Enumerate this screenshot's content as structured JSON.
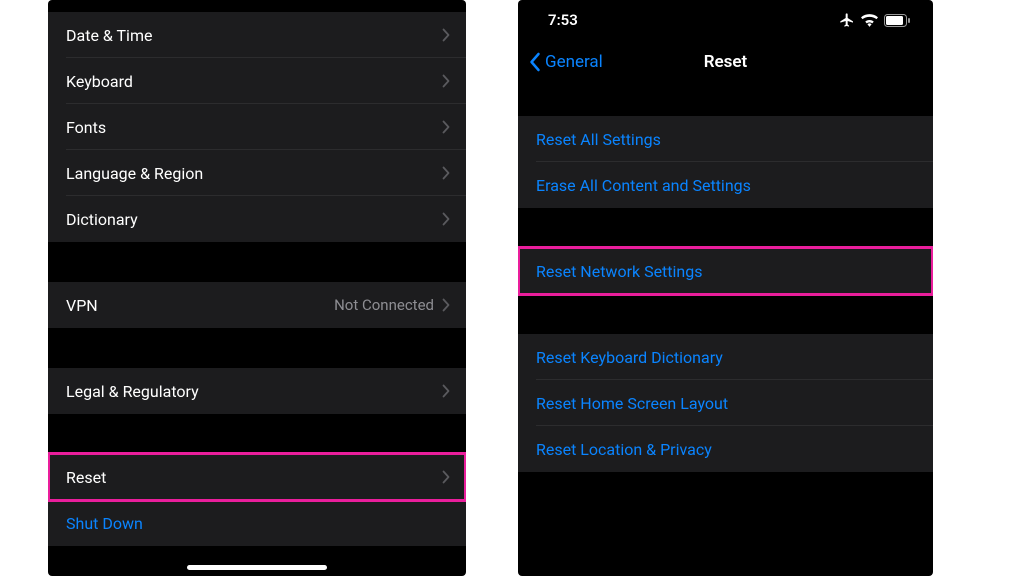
{
  "left": {
    "rows_g1": [
      {
        "label": "Date & Time"
      },
      {
        "label": "Keyboard"
      },
      {
        "label": "Fonts"
      },
      {
        "label": "Language & Region"
      },
      {
        "label": "Dictionary"
      }
    ],
    "rows_g2": [
      {
        "label": "VPN",
        "value": "Not Connected"
      }
    ],
    "rows_g3": [
      {
        "label": "Legal & Regulatory"
      }
    ],
    "rows_g4": [
      {
        "label": "Reset",
        "highlight": true
      },
      {
        "label": "Shut Down",
        "blue": true,
        "nochev": true
      }
    ]
  },
  "right": {
    "status_time": "7:53",
    "nav_back": "General",
    "nav_title": "Reset",
    "rows_g1": [
      {
        "label": "Reset All Settings",
        "blue": true
      },
      {
        "label": "Erase All Content and Settings",
        "blue": true
      }
    ],
    "rows_g2": [
      {
        "label": "Reset Network Settings",
        "blue": true,
        "highlight": true
      }
    ],
    "rows_g3": [
      {
        "label": "Reset Keyboard Dictionary",
        "blue": true
      },
      {
        "label": "Reset Home Screen Layout",
        "blue": true
      },
      {
        "label": "Reset Location & Privacy",
        "blue": true
      }
    ]
  }
}
